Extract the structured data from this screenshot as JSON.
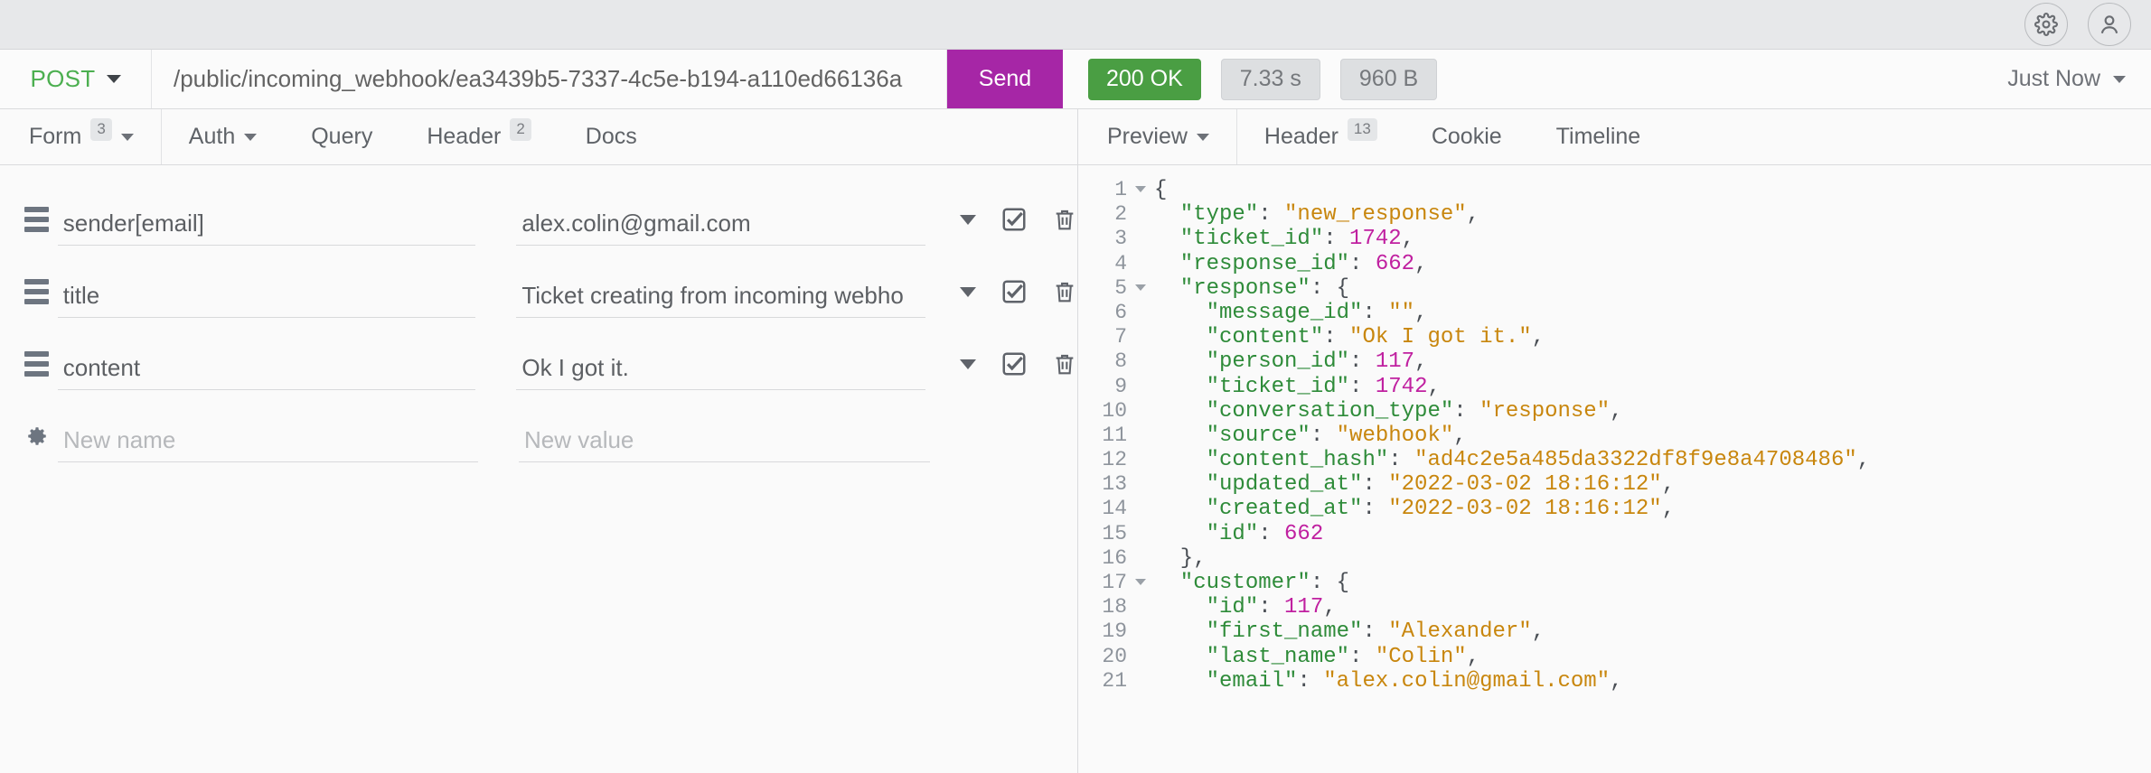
{
  "topbar": {
    "settings_icon": "gear-icon",
    "account_icon": "user-avatar-icon"
  },
  "request": {
    "method": "POST",
    "url": "/public/incoming_webhook/ea3439b5-7337-4c5e-b194-a110ed66136a",
    "send_label": "Send",
    "status_code": "200 OK",
    "duration": "7.33 s",
    "size": "960 B",
    "history_label": "Just Now"
  },
  "colors": {
    "send_button": "#a626a6",
    "status_ok": "#4a9e43",
    "method_post": "#4caf50",
    "json_key": "#2e8b39",
    "json_string": "#c8860d",
    "json_number": "#c020a0"
  },
  "left_tabs": [
    {
      "label": "Form",
      "badge": "3",
      "has_caret": true
    },
    {
      "label": "Auth",
      "badge": "",
      "has_caret": true
    },
    {
      "label": "Query",
      "badge": "",
      "has_caret": false
    },
    {
      "label": "Header",
      "badge": "2",
      "has_caret": false
    },
    {
      "label": "Docs",
      "badge": "",
      "has_caret": false
    }
  ],
  "right_tabs": [
    {
      "label": "Preview",
      "badge": "",
      "has_caret": true
    },
    {
      "label": "Header",
      "badge": "13",
      "has_caret": false
    },
    {
      "label": "Cookie",
      "badge": "",
      "has_caret": false
    },
    {
      "label": "Timeline",
      "badge": "",
      "has_caret": false
    }
  ],
  "form_rows": [
    {
      "name": "sender[email]",
      "value": "alex.colin@gmail.com",
      "enabled": true
    },
    {
      "name": "title",
      "value": "Ticket creating from incoming webho",
      "enabled": true
    },
    {
      "name": "content",
      "value": "Ok I got it.",
      "enabled": true
    }
  ],
  "new_row": {
    "name_placeholder": "New name",
    "value_placeholder": "New value"
  },
  "response_json": [
    {
      "no": "1",
      "fold": true,
      "tokens": [
        {
          "t": "p",
          "v": "{"
        }
      ]
    },
    {
      "no": "2",
      "fold": false,
      "tokens": [
        {
          "t": "k",
          "v": "  \"type\""
        },
        {
          "t": "p",
          "v": ": "
        },
        {
          "t": "s",
          "v": "\"new_response\""
        },
        {
          "t": "p",
          "v": ","
        }
      ]
    },
    {
      "no": "3",
      "fold": false,
      "tokens": [
        {
          "t": "k",
          "v": "  \"ticket_id\""
        },
        {
          "t": "p",
          "v": ": "
        },
        {
          "t": "n",
          "v": "1742"
        },
        {
          "t": "p",
          "v": ","
        }
      ]
    },
    {
      "no": "4",
      "fold": false,
      "tokens": [
        {
          "t": "k",
          "v": "  \"response_id\""
        },
        {
          "t": "p",
          "v": ": "
        },
        {
          "t": "n",
          "v": "662"
        },
        {
          "t": "p",
          "v": ","
        }
      ]
    },
    {
      "no": "5",
      "fold": true,
      "tokens": [
        {
          "t": "k",
          "v": "  \"response\""
        },
        {
          "t": "p",
          "v": ": {"
        }
      ]
    },
    {
      "no": "6",
      "fold": false,
      "tokens": [
        {
          "t": "k",
          "v": "    \"message_id\""
        },
        {
          "t": "p",
          "v": ": "
        },
        {
          "t": "s",
          "v": "\"\""
        },
        {
          "t": "p",
          "v": ","
        }
      ]
    },
    {
      "no": "7",
      "fold": false,
      "tokens": [
        {
          "t": "k",
          "v": "    \"content\""
        },
        {
          "t": "p",
          "v": ": "
        },
        {
          "t": "s",
          "v": "\"Ok I got it.\""
        },
        {
          "t": "p",
          "v": ","
        }
      ]
    },
    {
      "no": "8",
      "fold": false,
      "tokens": [
        {
          "t": "k",
          "v": "    \"person_id\""
        },
        {
          "t": "p",
          "v": ": "
        },
        {
          "t": "n",
          "v": "117"
        },
        {
          "t": "p",
          "v": ","
        }
      ]
    },
    {
      "no": "9",
      "fold": false,
      "tokens": [
        {
          "t": "k",
          "v": "    \"ticket_id\""
        },
        {
          "t": "p",
          "v": ": "
        },
        {
          "t": "n",
          "v": "1742"
        },
        {
          "t": "p",
          "v": ","
        }
      ]
    },
    {
      "no": "10",
      "fold": false,
      "tokens": [
        {
          "t": "k",
          "v": "    \"conversation_type\""
        },
        {
          "t": "p",
          "v": ": "
        },
        {
          "t": "s",
          "v": "\"response\""
        },
        {
          "t": "p",
          "v": ","
        }
      ]
    },
    {
      "no": "11",
      "fold": false,
      "tokens": [
        {
          "t": "k",
          "v": "    \"source\""
        },
        {
          "t": "p",
          "v": ": "
        },
        {
          "t": "s",
          "v": "\"webhook\""
        },
        {
          "t": "p",
          "v": ","
        }
      ]
    },
    {
      "no": "12",
      "fold": false,
      "tokens": [
        {
          "t": "k",
          "v": "    \"content_hash\""
        },
        {
          "t": "p",
          "v": ": "
        },
        {
          "t": "s",
          "v": "\"ad4c2e5a485da3322df8f9e8a4708486\""
        },
        {
          "t": "p",
          "v": ","
        }
      ]
    },
    {
      "no": "13",
      "fold": false,
      "tokens": [
        {
          "t": "k",
          "v": "    \"updated_at\""
        },
        {
          "t": "p",
          "v": ": "
        },
        {
          "t": "s",
          "v": "\"2022-03-02 18:16:12\""
        },
        {
          "t": "p",
          "v": ","
        }
      ]
    },
    {
      "no": "14",
      "fold": false,
      "tokens": [
        {
          "t": "k",
          "v": "    \"created_at\""
        },
        {
          "t": "p",
          "v": ": "
        },
        {
          "t": "s",
          "v": "\"2022-03-02 18:16:12\""
        },
        {
          "t": "p",
          "v": ","
        }
      ]
    },
    {
      "no": "15",
      "fold": false,
      "tokens": [
        {
          "t": "k",
          "v": "    \"id\""
        },
        {
          "t": "p",
          "v": ": "
        },
        {
          "t": "n",
          "v": "662"
        }
      ]
    },
    {
      "no": "16",
      "fold": false,
      "tokens": [
        {
          "t": "p",
          "v": "  },"
        }
      ]
    },
    {
      "no": "17",
      "fold": true,
      "tokens": [
        {
          "t": "k",
          "v": "  \"customer\""
        },
        {
          "t": "p",
          "v": ": {"
        }
      ]
    },
    {
      "no": "18",
      "fold": false,
      "tokens": [
        {
          "t": "k",
          "v": "    \"id\""
        },
        {
          "t": "p",
          "v": ": "
        },
        {
          "t": "n",
          "v": "117"
        },
        {
          "t": "p",
          "v": ","
        }
      ]
    },
    {
      "no": "19",
      "fold": false,
      "tokens": [
        {
          "t": "k",
          "v": "    \"first_name\""
        },
        {
          "t": "p",
          "v": ": "
        },
        {
          "t": "s",
          "v": "\"Alexander\""
        },
        {
          "t": "p",
          "v": ","
        }
      ]
    },
    {
      "no": "20",
      "fold": false,
      "tokens": [
        {
          "t": "k",
          "v": "    \"last_name\""
        },
        {
          "t": "p",
          "v": ": "
        },
        {
          "t": "s",
          "v": "\"Colin\""
        },
        {
          "t": "p",
          "v": ","
        }
      ]
    },
    {
      "no": "21",
      "fold": false,
      "tokens": [
        {
          "t": "k",
          "v": "    \"email\""
        },
        {
          "t": "p",
          "v": ": "
        },
        {
          "t": "s",
          "v": "\"alex.colin@gmail.com\""
        },
        {
          "t": "p",
          "v": ","
        }
      ]
    }
  ]
}
